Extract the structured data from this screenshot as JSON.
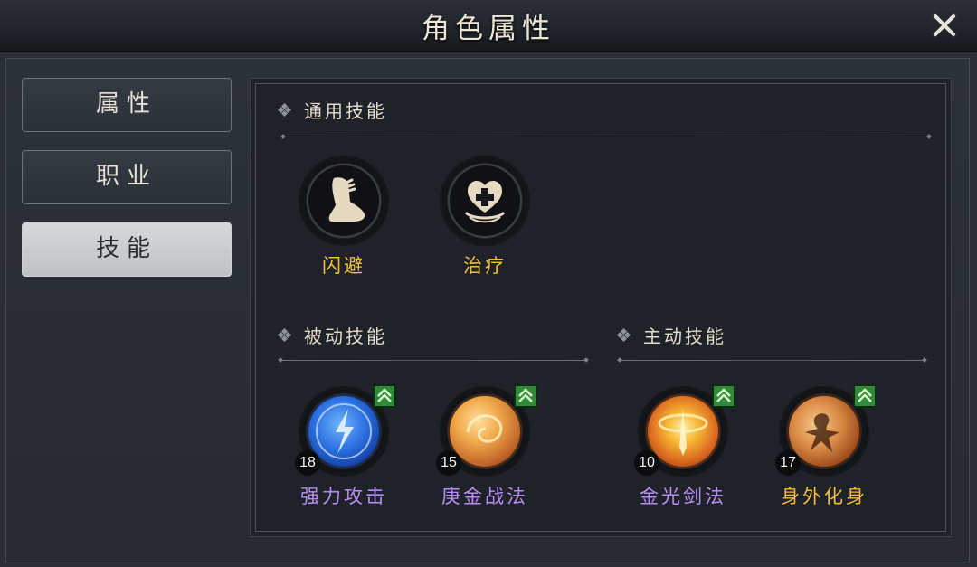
{
  "title": "角色属性",
  "tabs": [
    {
      "label": "属性",
      "active": false
    },
    {
      "label": "职业",
      "active": false
    },
    {
      "label": "技能",
      "active": true
    }
  ],
  "sections": {
    "general": {
      "title": "通用技能"
    },
    "passive": {
      "title": "被动技能"
    },
    "active": {
      "title": "主动技能"
    }
  },
  "general_skills": [
    {
      "name": "闪避",
      "icon": "dodge-foot-icon"
    },
    {
      "name": "治疗",
      "icon": "heal-heart-icon"
    }
  ],
  "passive_skills": [
    {
      "name": "强力攻击",
      "level": "18",
      "icon": "blue-lightning-orb-icon",
      "upgradable": true
    },
    {
      "name": "庚金战法",
      "level": "15",
      "icon": "golden-swirl-orb-icon",
      "upgradable": true
    }
  ],
  "active_skills": [
    {
      "name": "金光剑法",
      "level": "10",
      "icon": "golden-sword-orb-icon",
      "upgradable": true
    },
    {
      "name": "身外化身",
      "level": "17",
      "icon": "warrior-silhouette-orb-icon",
      "upgradable": true
    }
  ],
  "colors": {
    "label_gold": "#f0bd3f",
    "label_purple": "#b78cf5",
    "upgrade_green": "#2f8a3a"
  }
}
